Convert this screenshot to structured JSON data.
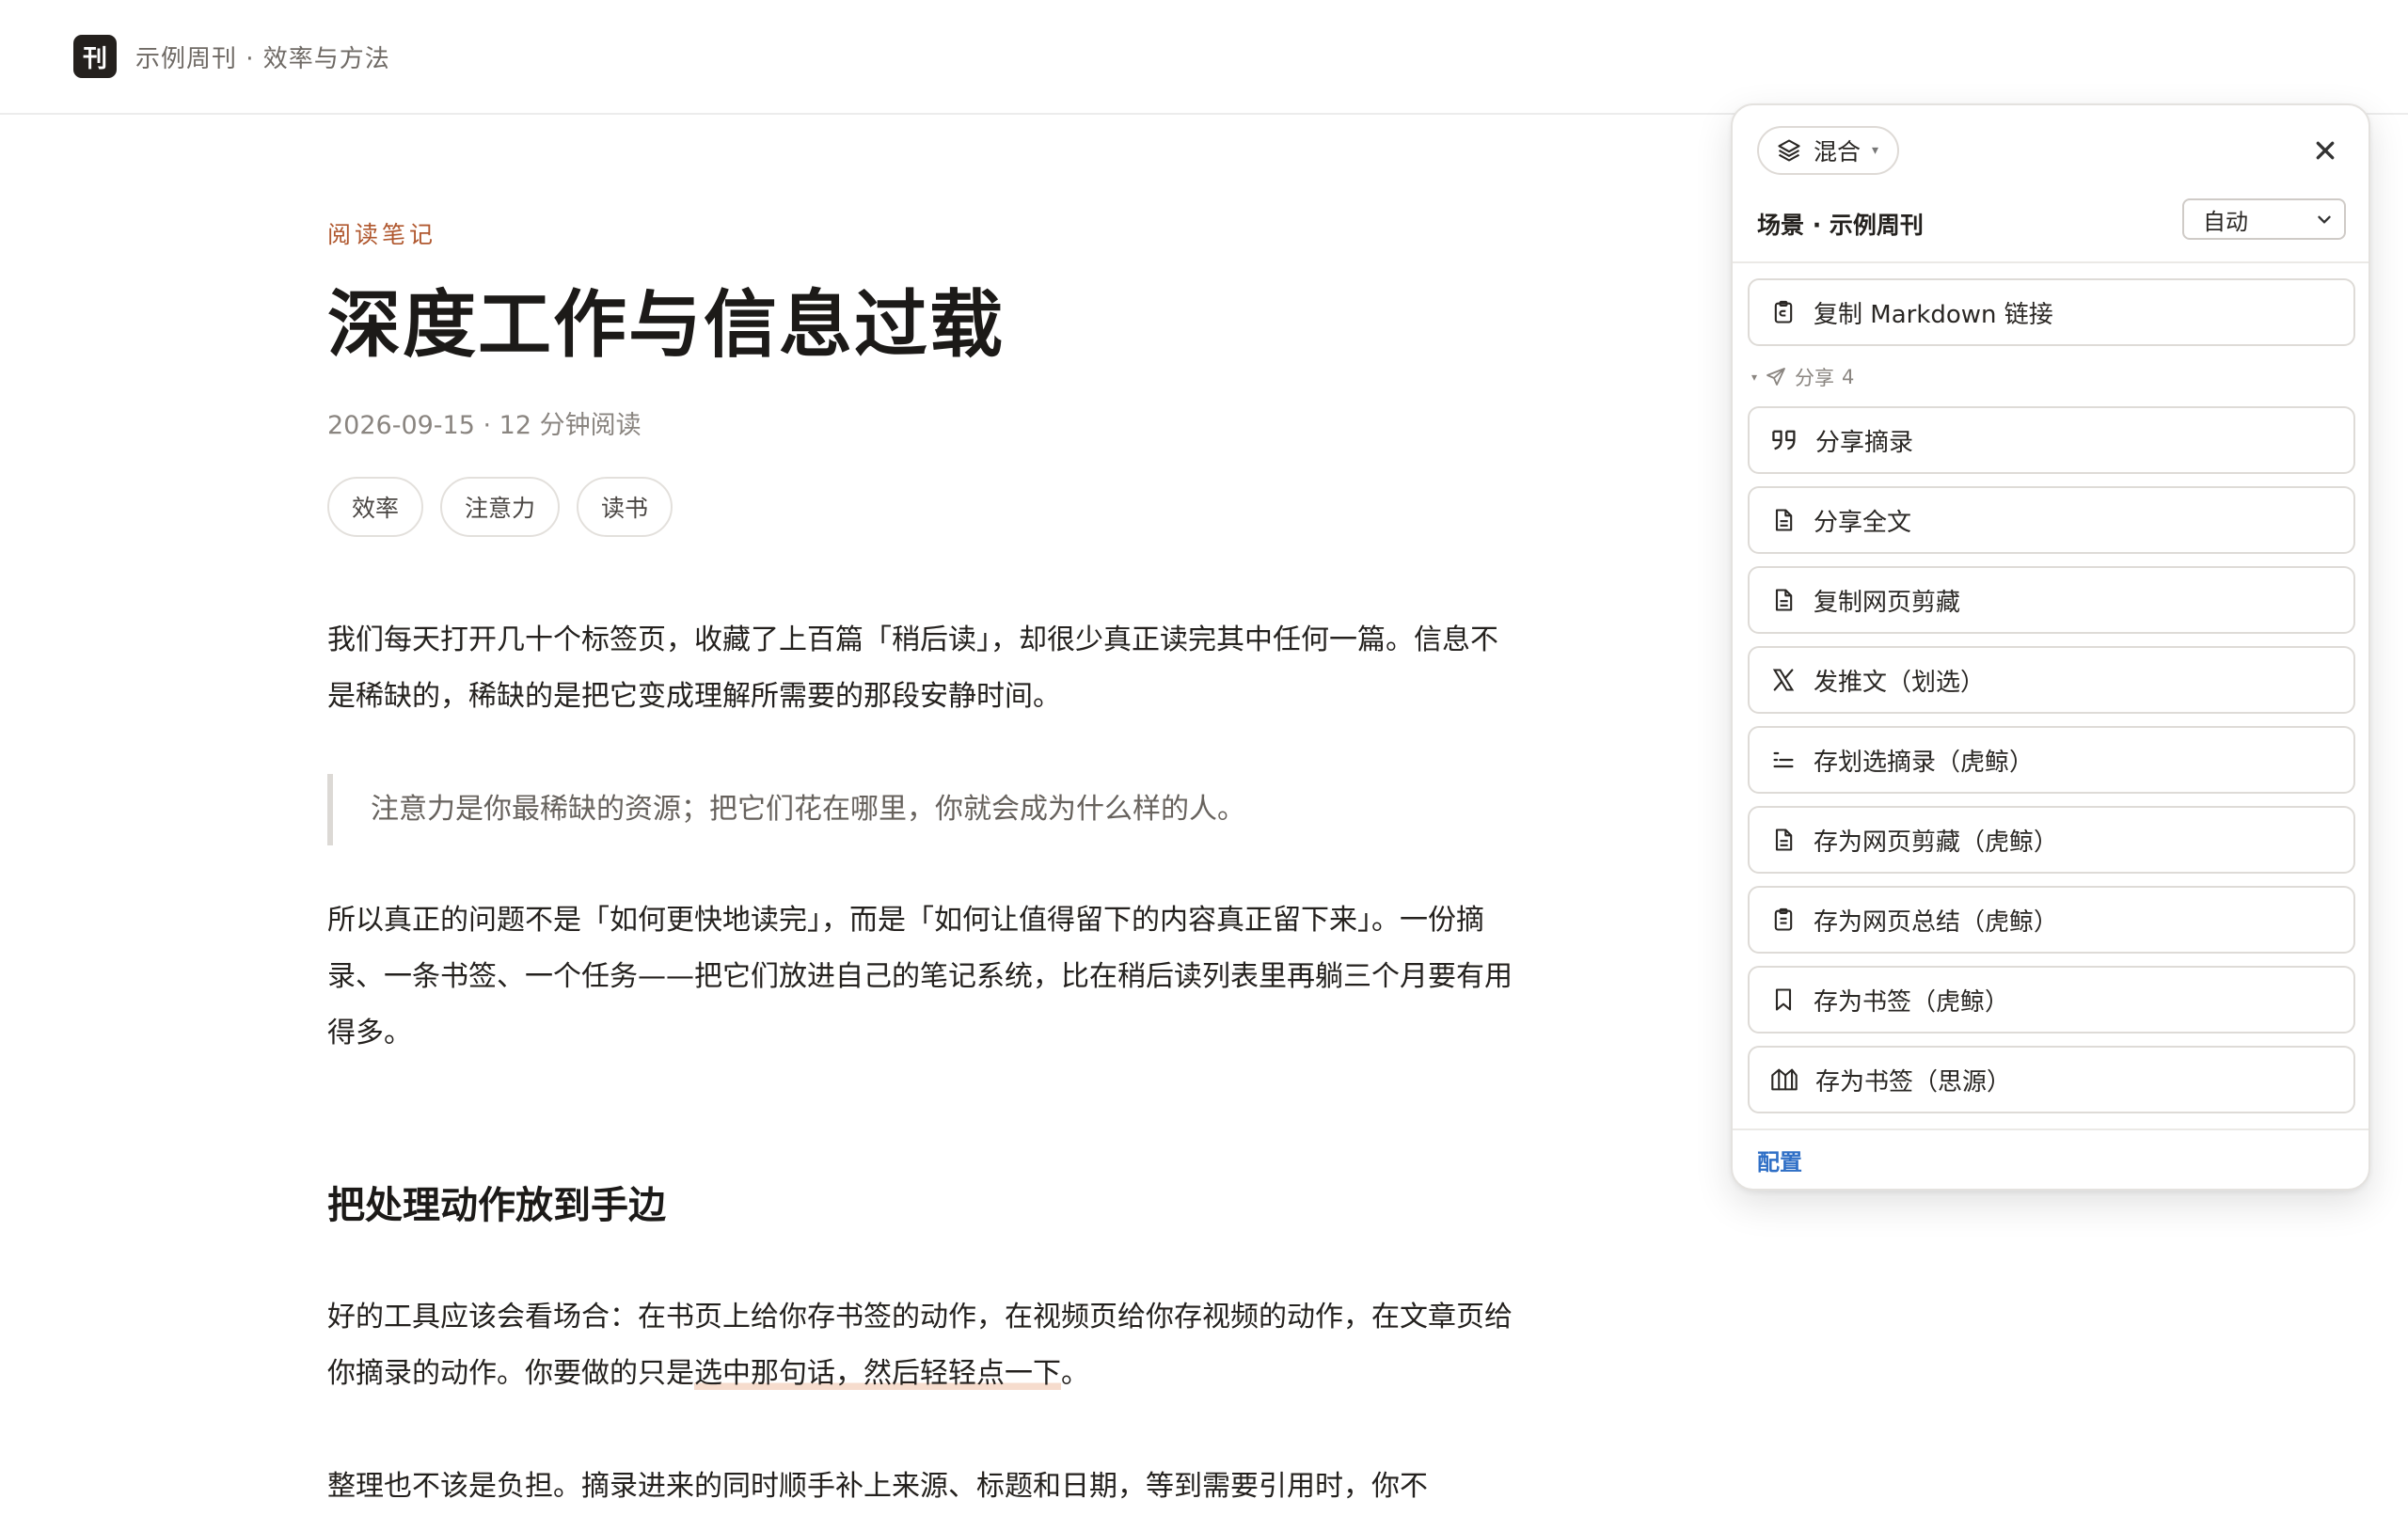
{
  "header": {
    "logo_text": "刊",
    "site_title": "示例周刊 · 效率与方法"
  },
  "article": {
    "category": "阅读笔记",
    "title": "深度工作与信息过载",
    "meta": "2026-09-15 · 12 分钟阅读",
    "tags": [
      "效率",
      "注意力",
      "读书"
    ],
    "p1": "我们每天打开几十个标签页，收藏了上百篇「稍后读」，却很少真正读完其中任何一篇。信息不是稀缺的，稀缺的是把它变成理解所需要的那段安静时间。",
    "quote": "注意力是你最稀缺的资源；把它们花在哪里，你就会成为什么样的人。",
    "p2": "所以真正的问题不是「如何更快地读完」，而是「如何让值得留下的内容真正留下来」。一份摘录、一条书签、一个任务——把它们放进自己的笔记系统，比在稍后读列表里再躺三个月要有用得多。",
    "h2": "把处理动作放到手边",
    "p3_before": "好的工具应该会看场合：在书页上给你存书签的动作，在视频页给你存视频的动作，在文章页给你摘录的动作。你要做的只是",
    "p3_highlight": "选中那句话，然后轻轻点一下",
    "p3_after": "。",
    "p4": "整理也不该是负担。摘录进来的同时顺手补上来源、标题和日期，等到需要引用时，你不"
  },
  "panel": {
    "mode_label": "混合",
    "scene_label": "场景 · 示例周刊",
    "scene_select": "自动",
    "copy_markdown": "复制 Markdown 链接",
    "share_section_label": "分享",
    "share_section_count": "4",
    "actions": [
      {
        "label": "分享摘录",
        "icon": "quote-icon"
      },
      {
        "label": "分享全文",
        "icon": "document-icon"
      },
      {
        "label": "复制网页剪藏",
        "icon": "document-icon"
      },
      {
        "label": "发推文（划选）",
        "icon": "x-logo-icon"
      },
      {
        "label": "存划选摘录（虎鲸）",
        "icon": "list-icon"
      },
      {
        "label": "存为网页剪藏（虎鲸）",
        "icon": "document-icon"
      },
      {
        "label": "存为网页总结（虎鲸）",
        "icon": "clipboard-icon"
      },
      {
        "label": "存为书签（虎鲸）",
        "icon": "bookmark-icon"
      },
      {
        "label": "存为书签（思源）",
        "icon": "siyuan-logo-icon"
      }
    ],
    "config_link": "配置"
  },
  "colors": {
    "accent_category": "#b0582f",
    "link_blue": "#2f6fc6",
    "highlight": "#f6dccd"
  }
}
